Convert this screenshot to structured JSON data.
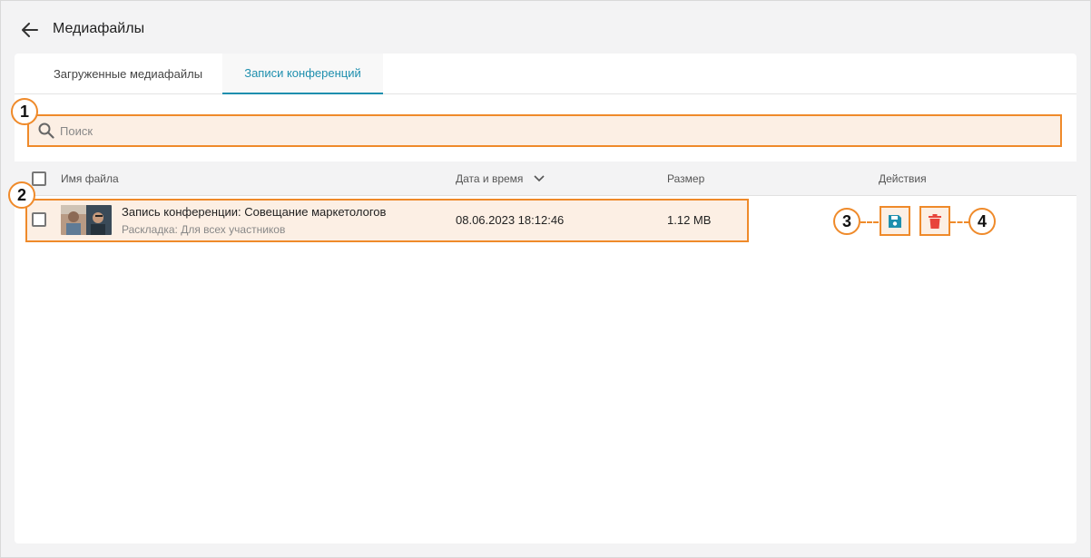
{
  "header": {
    "title": "Медиафайлы",
    "back_icon": "arrow-left-icon"
  },
  "tabs": [
    {
      "label": "Загруженные медиафайлы",
      "active": false
    },
    {
      "label": "Записи конференций",
      "active": true
    }
  ],
  "search": {
    "placeholder": "Поиск",
    "value": ""
  },
  "table": {
    "columns": {
      "name": "Имя файла",
      "datetime": "Дата и время",
      "size": "Размер",
      "actions": "Действия"
    },
    "rows": [
      {
        "title": "Запись конференции: Совещание маркетологов",
        "subtitle": "Раскладка: Для всех участников",
        "datetime": "08.06.2023 18:12:46",
        "size": "1.12 MB",
        "actions": [
          "save-icon",
          "trash-icon"
        ]
      }
    ]
  },
  "callouts": [
    "1",
    "2",
    "3",
    "4"
  ],
  "colors": {
    "accent": "#1e8fae",
    "highlight_border": "#ef8a2a",
    "highlight_fill": "#fcefe4",
    "delete": "#e8453c",
    "save": "#1e8fae"
  }
}
